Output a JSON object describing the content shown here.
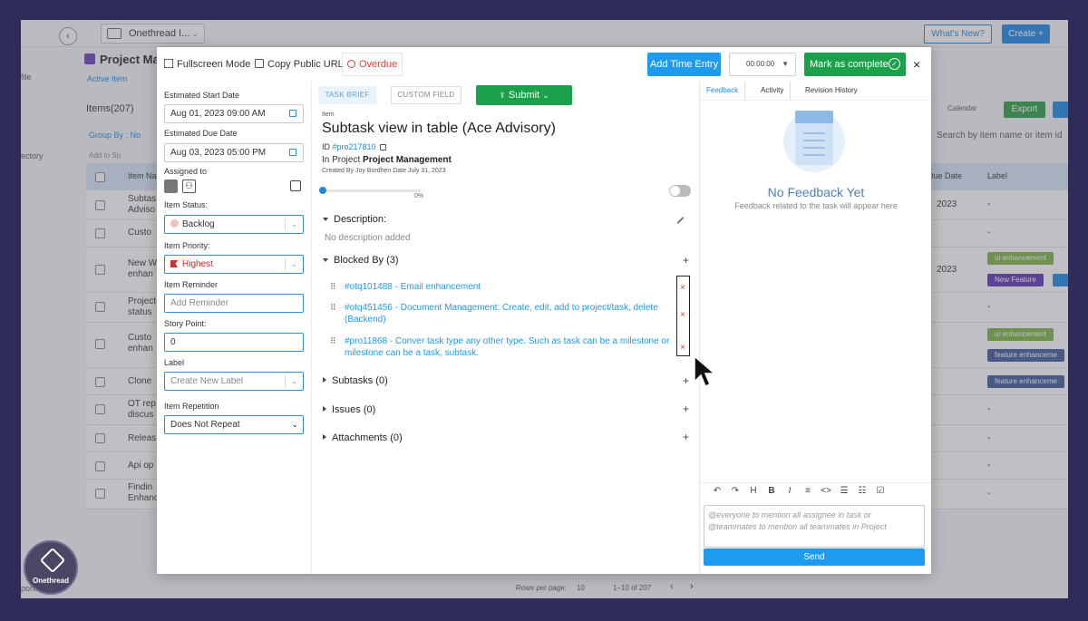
{
  "background": {
    "workspace": "Onethread I...",
    "whats_new": "What's New?",
    "create": "Create +",
    "project_title": "Project Ma",
    "active_item": "Active Item",
    "items_count": "Items(207)",
    "group_by": "Group By : No",
    "add_to": "Add to Sp",
    "export": "Export",
    "calendar": "Calendar",
    "search": "Search by item name or item id",
    "side_file": "file",
    "side_directory": "ectory",
    "side_report": "port",
    "columns": {
      "item_name": "Item Na",
      "due_date": "Due Date",
      "label": "Label"
    },
    "rows": [
      {
        "name": "Subtas\nAdviso",
        "date": "2023",
        "label": "-"
      },
      {
        "name": "Custo",
        "date": "",
        "label": "-"
      },
      {
        "name": "New W\nenhan",
        "date": "2023",
        "label": ""
      },
      {
        "name": "Project\nstatus",
        "date": "",
        "label": "-"
      },
      {
        "name": "Custo\nenhan",
        "date": "",
        "label": ""
      },
      {
        "name": "Clone",
        "date": "",
        "label": ""
      },
      {
        "name": "OT rep\ndiscus",
        "date": "",
        "label": "-"
      },
      {
        "name": "Releas",
        "date": "",
        "label": "-"
      },
      {
        "name": "Api op",
        "date": "",
        "label": "-"
      },
      {
        "name": "Findin\nEnhanc",
        "date": "",
        "label": "-"
      }
    ],
    "tags": [
      "ui enhancement",
      "New Feature",
      "ui enhancement",
      "feature enhanceme",
      "feature enhanceme"
    ],
    "rows_per_page": "Rows per page:",
    "rows_per_page_value": "10",
    "pagination": "1–10 of 207",
    "brand": "Onethread"
  },
  "header": {
    "fullscreen": "Fullscreen Mode",
    "copy_url": "Copy Public URL",
    "overdue": "Overdue",
    "add_time_entry": "Add Time Entry",
    "timer": "00:00:00",
    "mark_complete": "Mark as complete",
    "close": "×"
  },
  "left": {
    "est_start_label": "Estimated Start Date",
    "est_start_value": "Aug 01, 2023 09:00 AM",
    "est_due_label": "Estimated Due Date",
    "est_due_value": "Aug 03, 2023 05:00 PM",
    "assigned_label": "Assigned to",
    "status_label": "Item Status:",
    "status_value": "Backlog",
    "priority_label": "Item Priority:",
    "priority_value": "Highest",
    "reminder_label": "Item Reminder",
    "reminder_placeholder": "Add Reminder",
    "story_label": "Story Point:",
    "story_value": "0",
    "label_label": "Label",
    "label_placeholder": "Create New Label",
    "repetition_label": "Item Repetition",
    "repetition_value": "Does Not Repeat"
  },
  "middle": {
    "tab_brief": "TASK BRIEF",
    "tab_custom": "CUSTOM FIELD",
    "submit": "Submit",
    "item_label": "Item",
    "title": "Subtask view in table (Ace Advisory)",
    "id_prefix": "ID",
    "id_value": "#pro217810",
    "in_project_prefix": "In Project",
    "project_name": "Project Management",
    "created_by": "Created By  Joy Bordhen  Date July 31, 2023",
    "progress_value": 0,
    "progress_pct": "0%",
    "description_title": "Description:",
    "description_empty": "No description added",
    "blocked_title": "Blocked By (3)",
    "blocked": [
      "#otq101488 - Email enhancement",
      "#otq451456 - Document Management: Create, edit, add to project/task, delete (Backend)",
      "#pro11868 - Conver task type any other type. Such as task can be a milestone or milestone can be a task, subtask."
    ],
    "subtasks_title": "Subtasks (0)",
    "issues_title": "Issues (0)",
    "attachments_title": "Attachments (0)"
  },
  "right": {
    "tabs": [
      "Feedback",
      "Activity",
      "Revision History"
    ],
    "no_feedback_title": "No Feedback Yet",
    "no_feedback_sub": "Feedback related to the task will appear here",
    "comment_placeholder": "@everyone to mention all assignee in task or @teammates to mention all teammates in Project",
    "send": "Send"
  },
  "colors": {
    "accent": "#1e9aef",
    "success": "#1aa14a",
    "danger": "#e53935",
    "backdrop": "#2f2c5a"
  }
}
